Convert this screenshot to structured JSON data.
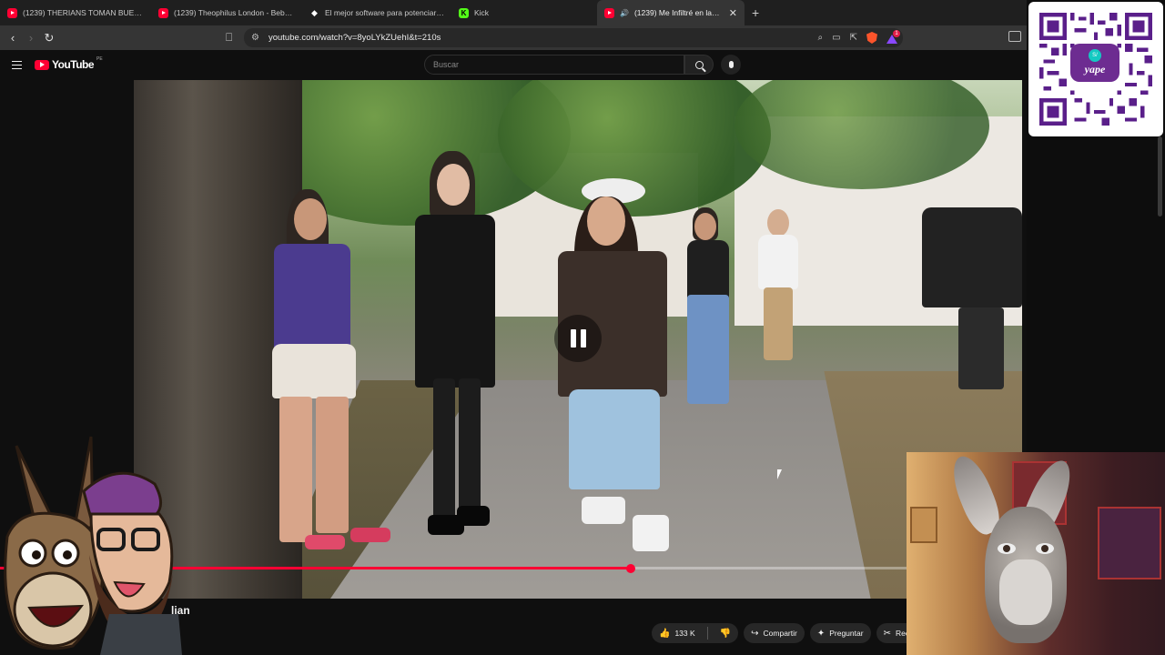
{
  "browser": {
    "tabs": [
      {
        "label": "(1239) THERIANS TOMAN BUENOS A",
        "icon": "youtube-icon",
        "active": false
      },
      {
        "label": "(1239) Theophilus London - Bebey (f",
        "icon": "youtube-icon",
        "active": false
      },
      {
        "label": "El mejor software para potenciar tu s",
        "icon": "gemini-icon",
        "active": false
      },
      {
        "label": "Kick",
        "icon": "kick-icon",
        "active": false
      },
      {
        "label": "(1239) Me Infiltré en la Comu",
        "icon": "youtube-icon",
        "active": true
      }
    ],
    "url": "youtube.com/watch?v=8yoLYkZUehI&t=210s",
    "rewards_badge": "1"
  },
  "youtube": {
    "logo_text": "YouTube",
    "logo_suffix": "PE",
    "search_placeholder": "Buscar",
    "video_title_fragment": "lian",
    "progress": 0.696,
    "actions": {
      "likes": "133 K",
      "share": "Compartir",
      "ask": "Preguntar",
      "clip": "Recortar"
    }
  },
  "overlays": {
    "qr_brand": "yape",
    "qr_brand_badge": "S/"
  },
  "colors": {
    "accent_red": "#ff0033",
    "yape_purple": "#6d2c91",
    "kick_green": "#53fc18"
  }
}
